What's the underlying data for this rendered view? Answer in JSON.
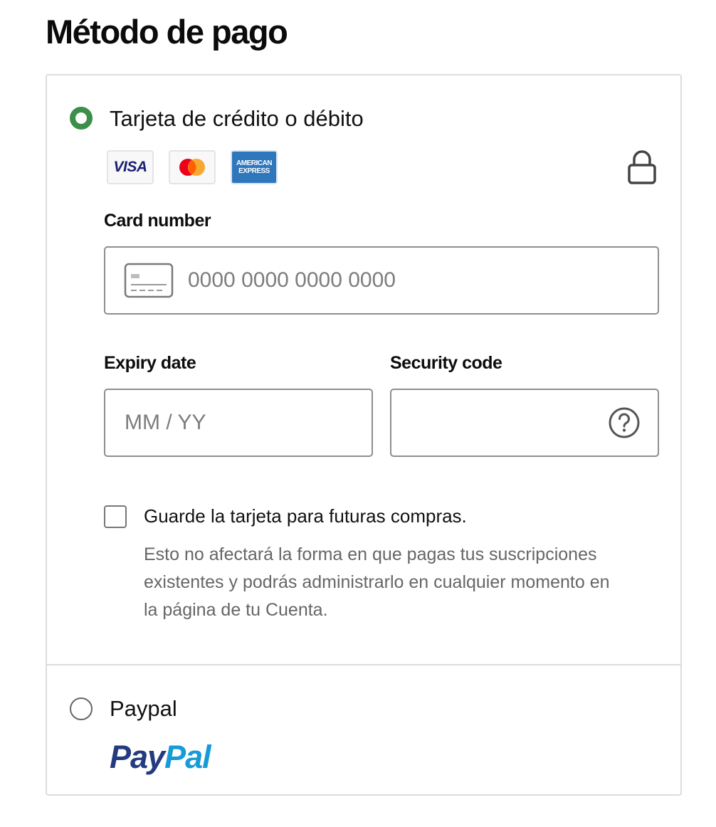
{
  "page": {
    "title": "Método de pago"
  },
  "payment_options": {
    "card": {
      "label": "Tarjeta de crédito o débito",
      "selected": true,
      "logos": {
        "visa": "VISA",
        "amex_line1": "AMERICAN",
        "amex_line2": "EXPRESS"
      },
      "card_number": {
        "label": "Card number",
        "placeholder": "0000 0000 0000 0000",
        "value": ""
      },
      "expiry": {
        "label": "Expiry date",
        "placeholder": "MM / YY",
        "value": ""
      },
      "security_code": {
        "label": "Security code",
        "placeholder": "",
        "value": ""
      },
      "save_card": {
        "label": "Guarde la tarjeta para futuras compras.",
        "checked": false,
        "help": "Esto no afectará la forma en que pagas tus suscripciones existentes y podrás administrarlo en cualquier momento en la página de tu Cuenta."
      }
    },
    "paypal": {
      "label": "Paypal",
      "selected": false,
      "logo_part1": "Pay",
      "logo_part2": "Pal"
    }
  },
  "icons": {
    "selected_radio": "radio-selected-icon",
    "unselected_radio": "radio-unselected-icon",
    "lock": "lock-icon",
    "card": "credit-card-icon",
    "help": "question-circle-icon"
  },
  "colors": {
    "accent_green": "#3c8f48",
    "visa_blue": "#1a1f71",
    "mastercard_red": "#eb001b",
    "mastercard_orange": "#f79e1b",
    "amex_blue": "#2e77bc",
    "paypal_dark": "#253b80",
    "paypal_light": "#179bd7"
  }
}
